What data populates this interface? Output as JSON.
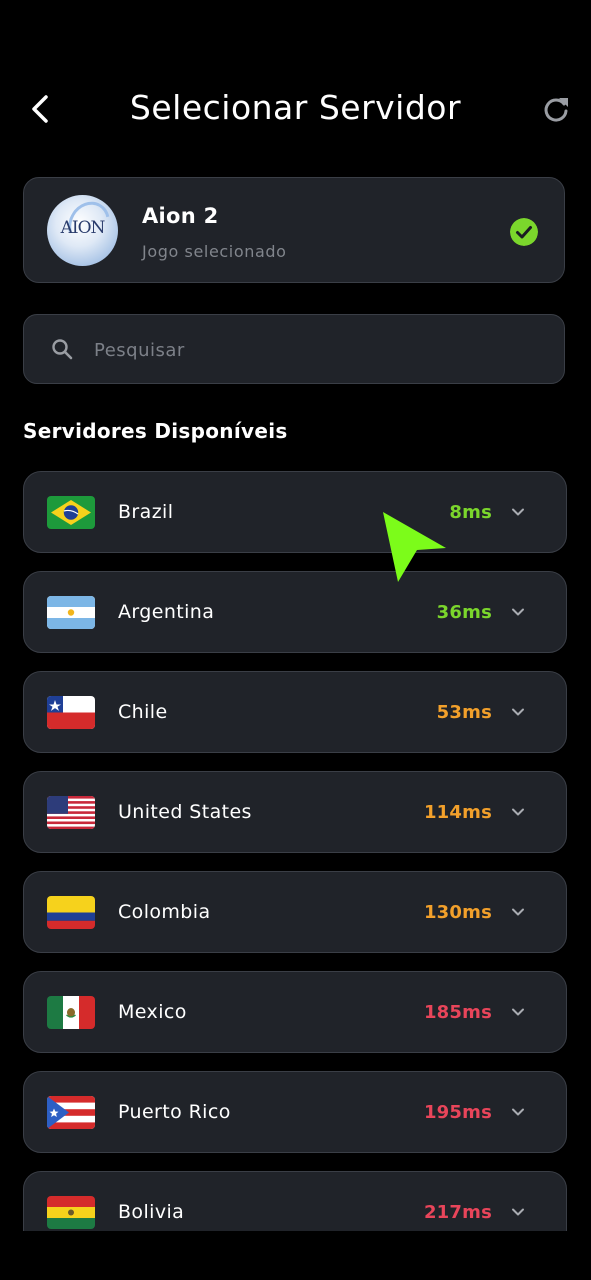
{
  "header": {
    "title": "Selecionar Servidor",
    "back_icon": "chevron-left-icon",
    "refresh_icon": "refresh-icon"
  },
  "game": {
    "name": "Aion 2",
    "subtitle": "Jogo selecionado",
    "logo_text": "AION",
    "selected_icon": "check-circle-icon",
    "accent_color": "#7bd62c"
  },
  "search": {
    "placeholder": "Pesquisar",
    "value": ""
  },
  "section": {
    "title": "Servidores Disponíveis"
  },
  "colors": {
    "good": "#7bd62c",
    "medium": "#f2a02b",
    "bad": "#e8455a",
    "card_bg": "#202329",
    "card_border": "#3a3e46",
    "cursor": "#7cfc1a"
  },
  "servers": [
    {
      "name": "Brazil",
      "latency": "8ms",
      "status": "good",
      "flag": "br"
    },
    {
      "name": "Argentina",
      "latency": "36ms",
      "status": "good",
      "flag": "ar"
    },
    {
      "name": "Chile",
      "latency": "53ms",
      "status": "medium",
      "flag": "cl"
    },
    {
      "name": "United States",
      "latency": "114ms",
      "status": "medium",
      "flag": "us"
    },
    {
      "name": "Colombia",
      "latency": "130ms",
      "status": "medium",
      "flag": "co"
    },
    {
      "name": "Mexico",
      "latency": "185ms",
      "status": "bad",
      "flag": "mx"
    },
    {
      "name": "Puerto Rico",
      "latency": "195ms",
      "status": "bad",
      "flag": "pr"
    },
    {
      "name": "Bolivia",
      "latency": "217ms",
      "status": "bad",
      "flag": "bo"
    }
  ]
}
